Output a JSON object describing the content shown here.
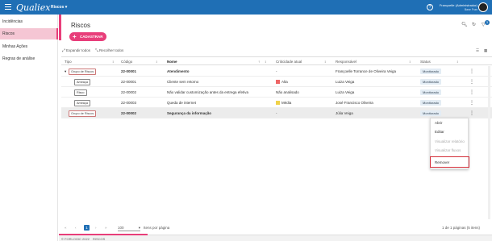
{
  "topbar": {
    "logo": "Qualiex",
    "module": "Riscos ▾",
    "help": "?",
    "user_name": "Françoelle (Administrador)",
    "user_role": "Base Fran"
  },
  "sidebar": {
    "items": [
      {
        "label": "Incidências"
      },
      {
        "label": "Riscos"
      },
      {
        "label": "Minhas Ações"
      },
      {
        "label": "Regras de análise"
      }
    ]
  },
  "page": {
    "title": "Riscos",
    "add_label": "CADASTRAR",
    "notification_count": "3"
  },
  "toolbar": {
    "expand_label": "Expandir todos",
    "collapse_label": "Recolher todos"
  },
  "table": {
    "headers": {
      "tipo": "Tipo",
      "codigo": "Código",
      "nome": "Nome",
      "criticidade": "Criticidade atual",
      "responsavel": "Responsável",
      "status": "Status"
    },
    "rows": [
      {
        "tipo": "Grupo de Riscos",
        "codigo": "22-00001",
        "nome": "Atendimento",
        "criticidade": "-",
        "crit_color": "",
        "responsavel": "Françoelle Torrance de Oliveira Veiga",
        "status": "Monitorado"
      },
      {
        "tipo": "Ameaça",
        "codigo": "22-00001",
        "nome": "Cliente sem retorno",
        "criticidade": "Alta",
        "crit_color": "#e66",
        "responsavel": "Luiza Veiga",
        "status": "Monitorado"
      },
      {
        "tipo": "Risco",
        "codigo": "22-00002",
        "nome": "Não validar customização antes da entrega efetiva",
        "criticidade": "Não analisado",
        "crit_color": "",
        "responsavel": "Luiza Veiga",
        "status": "Monitorado"
      },
      {
        "tipo": "Ameaça",
        "codigo": "22-00003",
        "nome": "Queda de internet",
        "criticidade": "Média",
        "crit_color": "#f0d24a",
        "responsavel": "José Francisco Oliveira",
        "status": "Monitorado"
      },
      {
        "tipo": "Grupo de Riscos",
        "codigo": "22-00002",
        "nome": "Segurança da informação",
        "criticidade": "-",
        "crit_color": "",
        "responsavel": "Júlia Veiga",
        "status": "Monitorado"
      }
    ]
  },
  "context_menu": {
    "items": [
      {
        "label": "Abrir",
        "disabled": false
      },
      {
        "label": "Editar",
        "disabled": false
      },
      {
        "label": "Visualizar relatório",
        "disabled": true
      },
      {
        "label": "Visualizar fluxos",
        "disabled": true
      },
      {
        "label": "Remover",
        "disabled": false
      }
    ]
  },
  "pager": {
    "first": "«",
    "prev": "‹",
    "current": "1",
    "next": "›",
    "last": "»",
    "per_page": "100",
    "per_page_label": "Itens por página",
    "summary": "1 de 1 páginas (5 itens)"
  },
  "footer": {
    "copyright": "© FORLOGIC 2022",
    "section": "RISCOS"
  },
  "colors": {
    "primary": "#1f6fb5",
    "accent": "#e83e7a",
    "highlight": "#d32f3a"
  }
}
